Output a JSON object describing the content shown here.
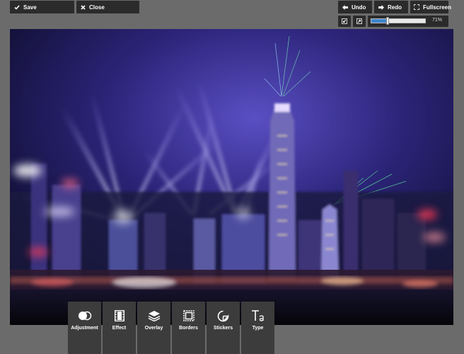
{
  "toolbar_top": {
    "save_label": "Save",
    "close_label": "Close",
    "undo_label": "Undo",
    "redo_label": "Redo",
    "fullscreen_label": "Fullscreen"
  },
  "zoom": {
    "value_text": "71%",
    "level": 0.29
  },
  "tools": [
    {
      "label": "Adjustment",
      "icon": "adjustment-icon"
    },
    {
      "label": "Effect",
      "icon": "film-icon"
    },
    {
      "label": "Overlay",
      "icon": "layers-icon"
    },
    {
      "label": "Borders",
      "icon": "border-frame-icon"
    },
    {
      "label": "Stickers",
      "icon": "sticker-icon"
    },
    {
      "label": "Type",
      "icon": "text-type-icon"
    }
  ],
  "colors": {
    "bar_bg": "#2b2b2b",
    "tool_bg": "#3c3c3c",
    "workspace_bg": "#6b6b6b",
    "slider_fill": "#3e86cf"
  }
}
